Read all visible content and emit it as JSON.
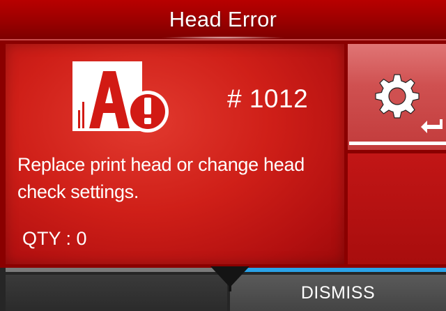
{
  "title": "Head Error",
  "error": {
    "code": "# 1012",
    "message": "Replace print head or change head check settings.",
    "qty": "QTY : 0",
    "icon": "head-error-icon"
  },
  "sidebar": {
    "settings_icon": "gear-icon",
    "enter_icon": "enter-icon"
  },
  "softkeys": {
    "right_label": "DISMISS"
  },
  "colors": {
    "title_bg": "#9a0000",
    "panel_bg": "#cf1f18",
    "settings_bg": "#cf5050",
    "accent_blue": "#2aa3e8",
    "bottom_bg": "#262626"
  }
}
